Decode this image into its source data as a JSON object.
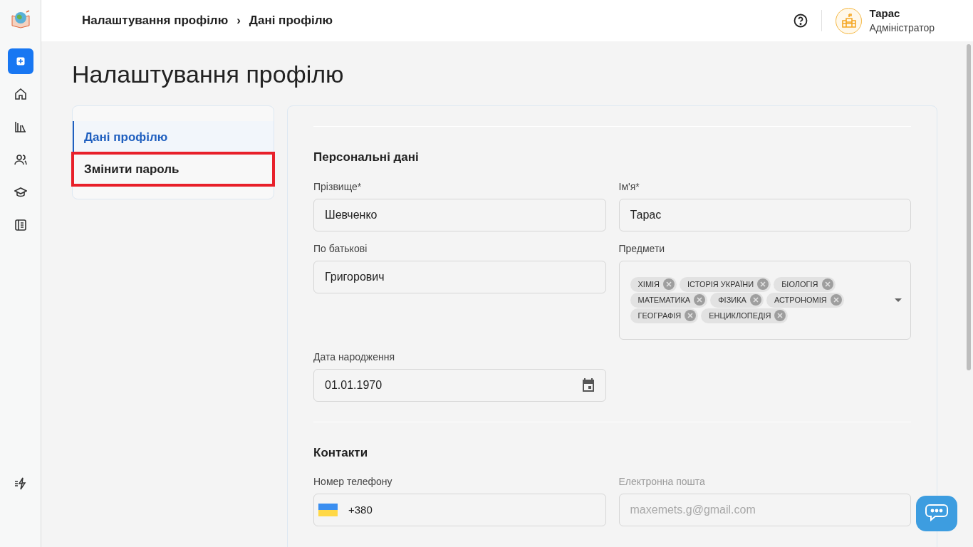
{
  "sidebar": {
    "items": [
      {
        "kind": "add",
        "selected": true
      },
      {
        "kind": "home",
        "selected": false
      },
      {
        "kind": "library",
        "selected": false
      },
      {
        "kind": "users",
        "selected": false
      },
      {
        "kind": "graduation",
        "selected": false
      },
      {
        "kind": "journal",
        "selected": false
      }
    ]
  },
  "header": {
    "breadcrumbs": [
      "Налаштування профілю",
      "Дані профілю"
    ],
    "breadcrumb_separator": "›",
    "user": {
      "name": "Тарас",
      "role": "Адміністратор"
    }
  },
  "page_title": "Налаштування профілю",
  "profile_menu": [
    {
      "label": "Дані профілю",
      "selected": true,
      "highlighted": false
    },
    {
      "label": "Змінити пароль",
      "selected": false,
      "highlighted": true
    }
  ],
  "sections": [
    {
      "title": "Персональні дані",
      "fields": [
        {
          "kind": "text",
          "label": "Прізвище*",
          "value": "Шевченко",
          "disabled": false
        },
        {
          "kind": "text",
          "label": "Ім'я*",
          "value": "Тарас",
          "disabled": false
        },
        {
          "kind": "text",
          "label": "По батькові",
          "value": "Григорович",
          "disabled": false
        },
        {
          "kind": "tags",
          "label": "Предмети",
          "tags": [
            "ХІМІЯ",
            "ІСТОРІЯ УКРАЇНИ",
            "БІОЛОГІЯ",
            "МАТЕМАТИКА",
            "ФІЗИКА",
            "АСТРОНОМІЯ",
            "ГЕОГРАФІЯ",
            "ЕНЦИКЛОПЕДІЯ"
          ]
        },
        {
          "kind": "date",
          "label": "Дата народження",
          "value": "01.01.1970"
        }
      ]
    },
    {
      "title": "Контакти",
      "fields": [
        {
          "kind": "phone",
          "label": "Номер телефону",
          "value": "+380"
        },
        {
          "kind": "text",
          "label": "Електронна пошта",
          "value": "maxemets.g@gmail.com",
          "disabled": true
        }
      ]
    }
  ]
}
